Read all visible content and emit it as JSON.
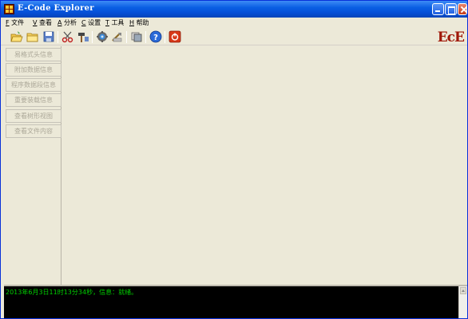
{
  "window": {
    "title": "E-Code Explorer"
  },
  "menu": [
    {
      "key": "F",
      "label": "文件"
    },
    {
      "key": "V",
      "label": "查看"
    },
    {
      "key": "A",
      "label": "分析"
    },
    {
      "key": "C",
      "label": "设置"
    },
    {
      "key": "T",
      "label": "工具"
    },
    {
      "key": "H",
      "label": "帮助"
    }
  ],
  "toolbar": {
    "buttons": [
      {
        "icon": "open-folder-icon"
      },
      {
        "icon": "folder-icon"
      },
      {
        "icon": "save-disk-icon"
      },
      {
        "icon": "scissors-icon"
      },
      {
        "icon": "hammer-icon"
      },
      {
        "icon": "gear-globe-icon"
      },
      {
        "icon": "tools-icon"
      },
      {
        "icon": "stack-icon"
      },
      {
        "icon": "help-icon"
      },
      {
        "icon": "power-icon"
      }
    ],
    "logo": "EcE"
  },
  "sidebar": {
    "buttons": [
      {
        "label": "易格式头信息"
      },
      {
        "label": "附加数据信息"
      },
      {
        "label": "程序数据段信息"
      },
      {
        "label": "重要装载信息"
      },
      {
        "label": "查看树形视图"
      },
      {
        "label": "查看文件内容"
      }
    ]
  },
  "console": {
    "message": "2013年6月3日11时13分34秒，信息：就绪。"
  },
  "colors": {
    "titlebar": "#0a5fe3",
    "console_bg": "#000000",
    "console_text": "#00d000",
    "logo": "#a01808"
  }
}
